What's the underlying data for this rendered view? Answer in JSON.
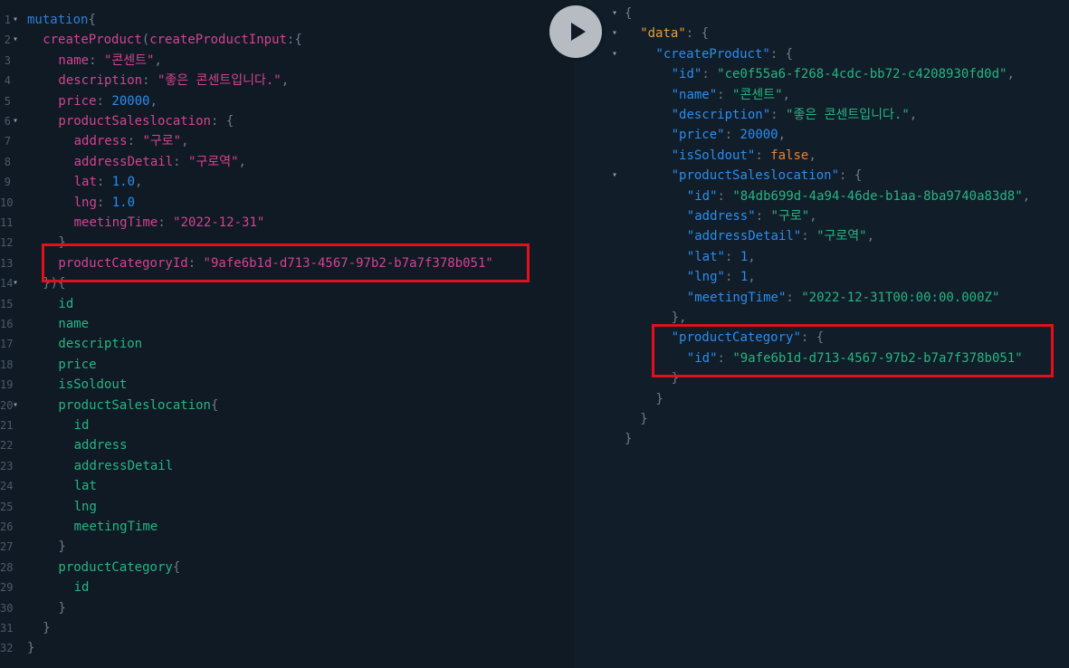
{
  "editor": {
    "lines": [
      {
        "n": "1",
        "fold": "▾",
        "indent": 0,
        "tokens": [
          {
            "t": "mutation",
            "c": "kw"
          },
          {
            "t": "{",
            "c": "pu"
          }
        ]
      },
      {
        "n": "2",
        "fold": "▾",
        "indent": 1,
        "tokens": [
          {
            "t": "createProduct",
            "c": "fn"
          },
          {
            "t": "(",
            "c": "pu"
          },
          {
            "t": "createProductInput",
            "c": "arg"
          },
          {
            "t": ":{",
            "c": "pu"
          }
        ]
      },
      {
        "n": "3",
        "fold": "",
        "indent": 2,
        "tokens": [
          {
            "t": "name",
            "c": "arg"
          },
          {
            "t": ": ",
            "c": "pu"
          },
          {
            "t": "\"콘센트\"",
            "c": "str"
          },
          {
            "t": ",",
            "c": "pu"
          }
        ]
      },
      {
        "n": "4",
        "fold": "",
        "indent": 2,
        "tokens": [
          {
            "t": "description",
            "c": "arg"
          },
          {
            "t": ": ",
            "c": "pu"
          },
          {
            "t": "\"좋은 콘센트입니다.\"",
            "c": "str"
          },
          {
            "t": ",",
            "c": "pu"
          }
        ]
      },
      {
        "n": "5",
        "fold": "",
        "indent": 2,
        "tokens": [
          {
            "t": "price",
            "c": "arg"
          },
          {
            "t": ": ",
            "c": "pu"
          },
          {
            "t": "20000",
            "c": "num"
          },
          {
            "t": ",",
            "c": "pu"
          }
        ]
      },
      {
        "n": "6",
        "fold": "▾",
        "indent": 2,
        "tokens": [
          {
            "t": "productSaleslocation",
            "c": "arg"
          },
          {
            "t": ": {",
            "c": "pu"
          }
        ]
      },
      {
        "n": "7",
        "fold": "",
        "indent": 3,
        "tokens": [
          {
            "t": "address",
            "c": "arg"
          },
          {
            "t": ": ",
            "c": "pu"
          },
          {
            "t": "\"구로\"",
            "c": "str"
          },
          {
            "t": ",",
            "c": "pu"
          }
        ]
      },
      {
        "n": "8",
        "fold": "",
        "indent": 3,
        "tokens": [
          {
            "t": "addressDetail",
            "c": "arg"
          },
          {
            "t": ": ",
            "c": "pu"
          },
          {
            "t": "\"구로역\"",
            "c": "str"
          },
          {
            "t": ",",
            "c": "pu"
          }
        ]
      },
      {
        "n": "9",
        "fold": "",
        "indent": 3,
        "tokens": [
          {
            "t": "lat",
            "c": "arg"
          },
          {
            "t": ": ",
            "c": "pu"
          },
          {
            "t": "1.0",
            "c": "num"
          },
          {
            "t": ",",
            "c": "pu"
          }
        ]
      },
      {
        "n": "10",
        "fold": "",
        "indent": 3,
        "tokens": [
          {
            "t": "lng",
            "c": "arg"
          },
          {
            "t": ": ",
            "c": "pu"
          },
          {
            "t": "1.0",
            "c": "num"
          }
        ]
      },
      {
        "n": "11",
        "fold": "",
        "indent": 3,
        "tokens": [
          {
            "t": "meetingTime",
            "c": "arg"
          },
          {
            "t": ": ",
            "c": "pu"
          },
          {
            "t": "\"2022-12-31\"",
            "c": "str"
          }
        ]
      },
      {
        "n": "12",
        "fold": "",
        "indent": 2,
        "tokens": [
          {
            "t": "}",
            "c": "pu"
          }
        ]
      },
      {
        "n": "13",
        "fold": "",
        "indent": 2,
        "tokens": [
          {
            "t": "productCategoryId",
            "c": "arg"
          },
          {
            "t": ": ",
            "c": "pu"
          },
          {
            "t": "\"9afe6b1d-d713-4567-97b2-b7a7f378b051\"",
            "c": "str"
          }
        ]
      },
      {
        "n": "14",
        "fold": "▾",
        "indent": 1,
        "tokens": [
          {
            "t": "}){",
            "c": "pu"
          }
        ]
      },
      {
        "n": "15",
        "fold": "",
        "indent": 2,
        "tokens": [
          {
            "t": "id",
            "c": "fld"
          }
        ]
      },
      {
        "n": "16",
        "fold": "",
        "indent": 2,
        "tokens": [
          {
            "t": "name",
            "c": "fld"
          }
        ]
      },
      {
        "n": "17",
        "fold": "",
        "indent": 2,
        "tokens": [
          {
            "t": "description",
            "c": "fld"
          }
        ]
      },
      {
        "n": "18",
        "fold": "",
        "indent": 2,
        "tokens": [
          {
            "t": "price",
            "c": "fld"
          }
        ]
      },
      {
        "n": "19",
        "fold": "",
        "indent": 2,
        "tokens": [
          {
            "t": "isSoldout",
            "c": "fld"
          }
        ]
      },
      {
        "n": "20",
        "fold": "▾",
        "indent": 2,
        "tokens": [
          {
            "t": "productSaleslocation",
            "c": "fld"
          },
          {
            "t": "{",
            "c": "pu"
          }
        ]
      },
      {
        "n": "21",
        "fold": "",
        "indent": 3,
        "tokens": [
          {
            "t": "id",
            "c": "fld"
          }
        ]
      },
      {
        "n": "22",
        "fold": "",
        "indent": 3,
        "tokens": [
          {
            "t": "address",
            "c": "fld"
          }
        ]
      },
      {
        "n": "23",
        "fold": "",
        "indent": 3,
        "tokens": [
          {
            "t": "addressDetail",
            "c": "fld"
          }
        ]
      },
      {
        "n": "24",
        "fold": "",
        "indent": 3,
        "tokens": [
          {
            "t": "lat",
            "c": "fld"
          }
        ]
      },
      {
        "n": "25",
        "fold": "",
        "indent": 3,
        "tokens": [
          {
            "t": "lng",
            "c": "fld"
          }
        ]
      },
      {
        "n": "26",
        "fold": "",
        "indent": 3,
        "tokens": [
          {
            "t": "meetingTime",
            "c": "fld"
          }
        ]
      },
      {
        "n": "27",
        "fold": "",
        "indent": 2,
        "tokens": [
          {
            "t": "}",
            "c": "pu"
          }
        ]
      },
      {
        "n": "28",
        "fold": "",
        "indent": 2,
        "tokens": [
          {
            "t": "productCategory",
            "c": "fld"
          },
          {
            "t": "{",
            "c": "pu"
          }
        ]
      },
      {
        "n": "29",
        "fold": "",
        "indent": 3,
        "tokens": [
          {
            "t": "id",
            "c": "fld"
          }
        ]
      },
      {
        "n": "30",
        "fold": "",
        "indent": 2,
        "tokens": [
          {
            "t": "}",
            "c": "pu"
          }
        ]
      },
      {
        "n": "31",
        "fold": "",
        "indent": 1,
        "tokens": [
          {
            "t": "}",
            "c": "pu"
          }
        ]
      },
      {
        "n": "32",
        "fold": "",
        "indent": 0,
        "tokens": [
          {
            "t": "}",
            "c": "pu"
          }
        ]
      }
    ]
  },
  "result": {
    "lines": [
      {
        "fold": "▾",
        "indent": 0,
        "tokens": [
          {
            "t": "{",
            "c": "pu"
          }
        ]
      },
      {
        "fold": "▾",
        "indent": 1,
        "tokens": [
          {
            "t": "\"data\"",
            "c": "rkd"
          },
          {
            "t": ": {",
            "c": "pu"
          }
        ]
      },
      {
        "fold": "▾",
        "indent": 2,
        "tokens": [
          {
            "t": "\"createProduct\"",
            "c": "rk"
          },
          {
            "t": ": {",
            "c": "pu"
          }
        ]
      },
      {
        "fold": "",
        "indent": 3,
        "tokens": [
          {
            "t": "\"id\"",
            "c": "rk"
          },
          {
            "t": ": ",
            "c": "pu"
          },
          {
            "t": "\"ce0f55a6-f268-4cdc-bb72-c4208930fd0d\"",
            "c": "rs"
          },
          {
            "t": ",",
            "c": "pu"
          }
        ]
      },
      {
        "fold": "",
        "indent": 3,
        "tokens": [
          {
            "t": "\"name\"",
            "c": "rk"
          },
          {
            "t": ": ",
            "c": "pu"
          },
          {
            "t": "\"콘센트\"",
            "c": "rs"
          },
          {
            "t": ",",
            "c": "pu"
          }
        ]
      },
      {
        "fold": "",
        "indent": 3,
        "tokens": [
          {
            "t": "\"description\"",
            "c": "rk"
          },
          {
            "t": ": ",
            "c": "pu"
          },
          {
            "t": "\"좋은 콘센트입니다.\"",
            "c": "rs"
          },
          {
            "t": ",",
            "c": "pu"
          }
        ]
      },
      {
        "fold": "",
        "indent": 3,
        "tokens": [
          {
            "t": "\"price\"",
            "c": "rk"
          },
          {
            "t": ": ",
            "c": "pu"
          },
          {
            "t": "20000",
            "c": "rn"
          },
          {
            "t": ",",
            "c": "pu"
          }
        ]
      },
      {
        "fold": "",
        "indent": 3,
        "tokens": [
          {
            "t": "\"isSoldout\"",
            "c": "rk"
          },
          {
            "t": ": ",
            "c": "pu"
          },
          {
            "t": "false",
            "c": "rb"
          },
          {
            "t": ",",
            "c": "pu"
          }
        ]
      },
      {
        "fold": "▾",
        "indent": 3,
        "tokens": [
          {
            "t": "\"productSaleslocation\"",
            "c": "rk"
          },
          {
            "t": ": {",
            "c": "pu"
          }
        ]
      },
      {
        "fold": "",
        "indent": 4,
        "tokens": [
          {
            "t": "\"id\"",
            "c": "rk"
          },
          {
            "t": ": ",
            "c": "pu"
          },
          {
            "t": "\"84db699d-4a94-46de-b1aa-8ba9740a83d8\"",
            "c": "rs"
          },
          {
            "t": ",",
            "c": "pu"
          }
        ]
      },
      {
        "fold": "",
        "indent": 4,
        "tokens": [
          {
            "t": "\"address\"",
            "c": "rk"
          },
          {
            "t": ": ",
            "c": "pu"
          },
          {
            "t": "\"구로\"",
            "c": "rs"
          },
          {
            "t": ",",
            "c": "pu"
          }
        ]
      },
      {
        "fold": "",
        "indent": 4,
        "tokens": [
          {
            "t": "\"addressDetail\"",
            "c": "rk"
          },
          {
            "t": ": ",
            "c": "pu"
          },
          {
            "t": "\"구로역\"",
            "c": "rs"
          },
          {
            "t": ",",
            "c": "pu"
          }
        ]
      },
      {
        "fold": "",
        "indent": 4,
        "tokens": [
          {
            "t": "\"lat\"",
            "c": "rk"
          },
          {
            "t": ": ",
            "c": "pu"
          },
          {
            "t": "1",
            "c": "rn"
          },
          {
            "t": ",",
            "c": "pu"
          }
        ]
      },
      {
        "fold": "",
        "indent": 4,
        "tokens": [
          {
            "t": "\"lng\"",
            "c": "rk"
          },
          {
            "t": ": ",
            "c": "pu"
          },
          {
            "t": "1",
            "c": "rn"
          },
          {
            "t": ",",
            "c": "pu"
          }
        ]
      },
      {
        "fold": "",
        "indent": 4,
        "tokens": [
          {
            "t": "\"meetingTime\"",
            "c": "rk"
          },
          {
            "t": ": ",
            "c": "pu"
          },
          {
            "t": "\"2022-12-31T00:00:00.000Z\"",
            "c": "rs"
          }
        ]
      },
      {
        "fold": "",
        "indent": 3,
        "tokens": [
          {
            "t": "},",
            "c": "pu"
          }
        ]
      },
      {
        "fold": "",
        "indent": 3,
        "tokens": [
          {
            "t": "\"productCategory\"",
            "c": "rk"
          },
          {
            "t": ": {",
            "c": "pu"
          }
        ]
      },
      {
        "fold": "",
        "indent": 4,
        "tokens": [
          {
            "t": "\"id\"",
            "c": "rk"
          },
          {
            "t": ": ",
            "c": "pu"
          },
          {
            "t": "\"9afe6b1d-d713-4567-97b2-b7a7f378b051\"",
            "c": "rs"
          }
        ]
      },
      {
        "fold": "",
        "indent": 3,
        "tokens": [
          {
            "t": "}",
            "c": "pu"
          }
        ]
      },
      {
        "fold": "",
        "indent": 2,
        "tokens": [
          {
            "t": "}",
            "c": "pu"
          }
        ]
      },
      {
        "fold": "",
        "indent": 1,
        "tokens": [
          {
            "t": "}",
            "c": "pu"
          }
        ]
      },
      {
        "fold": "",
        "indent": 0,
        "tokens": [
          {
            "t": "}",
            "c": "pu"
          }
        ]
      }
    ]
  },
  "run_button": {
    "icon": "play-icon"
  },
  "colors": {
    "background": "#0f1a24",
    "highlight": "#e0101c"
  }
}
